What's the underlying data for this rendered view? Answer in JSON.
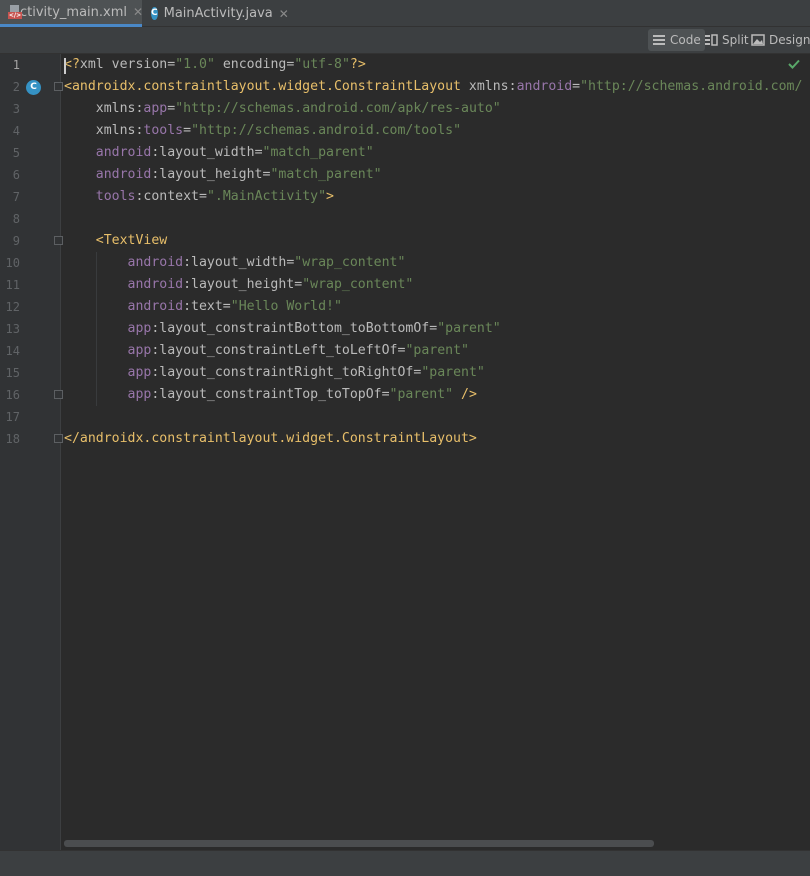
{
  "tabs": [
    {
      "label": "activity_main.xml",
      "icon": "xml-file-icon",
      "active": true,
      "close": "✕"
    },
    {
      "label": "MainActivity.java",
      "icon": "java-class-icon",
      "active": false,
      "close": "✕"
    }
  ],
  "view_modes": [
    {
      "label": "Code",
      "icon": "code-view-icon",
      "selected": true
    },
    {
      "label": "Split",
      "icon": "split-view-icon",
      "selected": false
    },
    {
      "label": "Design",
      "icon": "design-view-icon",
      "selected": false
    }
  ],
  "editor": {
    "current_line": 1,
    "lines": [
      {
        "n": "1",
        "tokens": [
          [
            "pi",
            "<?"
          ],
          [
            "attr",
            "xml version"
          ],
          [
            "attr",
            "="
          ],
          [
            "val",
            "\"1.0\""
          ],
          [
            "attr",
            " encoding"
          ],
          [
            "attr",
            "="
          ],
          [
            "val",
            "\"utf-8\""
          ],
          [
            "pi",
            "?>"
          ]
        ]
      },
      {
        "n": "2",
        "tokens": [
          [
            "tag",
            "<androidx.constraintlayout.widget.ConstraintLayout "
          ],
          [
            "attr",
            "xmlns:"
          ],
          [
            "ns",
            "android"
          ],
          [
            "attr",
            "="
          ],
          [
            "val",
            "\"http://schemas.android.com/"
          ]
        ]
      },
      {
        "n": "3",
        "tokens": [
          [
            "attr",
            "    xmlns:"
          ],
          [
            "ns",
            "app"
          ],
          [
            "attr",
            "="
          ],
          [
            "val",
            "\"http://schemas.android.com/apk/res-auto\""
          ]
        ]
      },
      {
        "n": "4",
        "tokens": [
          [
            "attr",
            "    xmlns:"
          ],
          [
            "ns",
            "tools"
          ],
          [
            "attr",
            "="
          ],
          [
            "val",
            "\"http://schemas.android.com/tools\""
          ]
        ]
      },
      {
        "n": "5",
        "tokens": [
          [
            "ns",
            "    android"
          ],
          [
            "attr",
            ":layout_width"
          ],
          [
            "attr",
            "="
          ],
          [
            "val",
            "\"match_parent\""
          ]
        ]
      },
      {
        "n": "6",
        "tokens": [
          [
            "ns",
            "    android"
          ],
          [
            "attr",
            ":layout_height"
          ],
          [
            "attr",
            "="
          ],
          [
            "val",
            "\"match_parent\""
          ]
        ]
      },
      {
        "n": "7",
        "tokens": [
          [
            "ns",
            "    tools"
          ],
          [
            "attr",
            ":context"
          ],
          [
            "attr",
            "="
          ],
          [
            "val",
            "\".MainActivity\""
          ],
          [
            "tag",
            ">"
          ]
        ]
      },
      {
        "n": "8",
        "tokens": []
      },
      {
        "n": "9",
        "tokens": [
          [
            "tag",
            "    <TextView"
          ]
        ]
      },
      {
        "n": "10",
        "tokens": [
          [
            "ns",
            "        android"
          ],
          [
            "attr",
            ":layout_width"
          ],
          [
            "attr",
            "="
          ],
          [
            "val",
            "\"wrap_content\""
          ]
        ]
      },
      {
        "n": "11",
        "tokens": [
          [
            "ns",
            "        android"
          ],
          [
            "attr",
            ":layout_height"
          ],
          [
            "attr",
            "="
          ],
          [
            "val",
            "\"wrap_content\""
          ]
        ]
      },
      {
        "n": "12",
        "tokens": [
          [
            "ns",
            "        android"
          ],
          [
            "attr",
            ":text"
          ],
          [
            "attr",
            "="
          ],
          [
            "val",
            "\"Hello World!\""
          ]
        ]
      },
      {
        "n": "13",
        "tokens": [
          [
            "ns",
            "        app"
          ],
          [
            "attr",
            ":layout_constraintBottom_toBottomOf"
          ],
          [
            "attr",
            "="
          ],
          [
            "val",
            "\"parent\""
          ]
        ]
      },
      {
        "n": "14",
        "tokens": [
          [
            "ns",
            "        app"
          ],
          [
            "attr",
            ":layout_constraintLeft_toLeftOf"
          ],
          [
            "attr",
            "="
          ],
          [
            "val",
            "\"parent\""
          ]
        ]
      },
      {
        "n": "15",
        "tokens": [
          [
            "ns",
            "        app"
          ],
          [
            "attr",
            ":layout_constraintRight_toRightOf"
          ],
          [
            "attr",
            "="
          ],
          [
            "val",
            "\"parent\""
          ]
        ]
      },
      {
        "n": "16",
        "tokens": [
          [
            "ns",
            "        app"
          ],
          [
            "attr",
            ":layout_constraintTop_toTopOf"
          ],
          [
            "attr",
            "="
          ],
          [
            "val",
            "\"parent\""
          ],
          [
            "tag",
            " />"
          ]
        ]
      },
      {
        "n": "17",
        "tokens": []
      },
      {
        "n": "18",
        "tokens": [
          [
            "tag",
            "</androidx.constraintlayout.widget.ConstraintLayout>"
          ]
        ]
      }
    ]
  },
  "gutter_marker": "C",
  "status_icon": "check-icon",
  "colors": {
    "tag": "#e8bf6a",
    "attribute": "#bababa",
    "namespace": "#9876aa",
    "value": "#6a8759",
    "background": "#2b2b2b",
    "accent": "#4a88c7"
  }
}
